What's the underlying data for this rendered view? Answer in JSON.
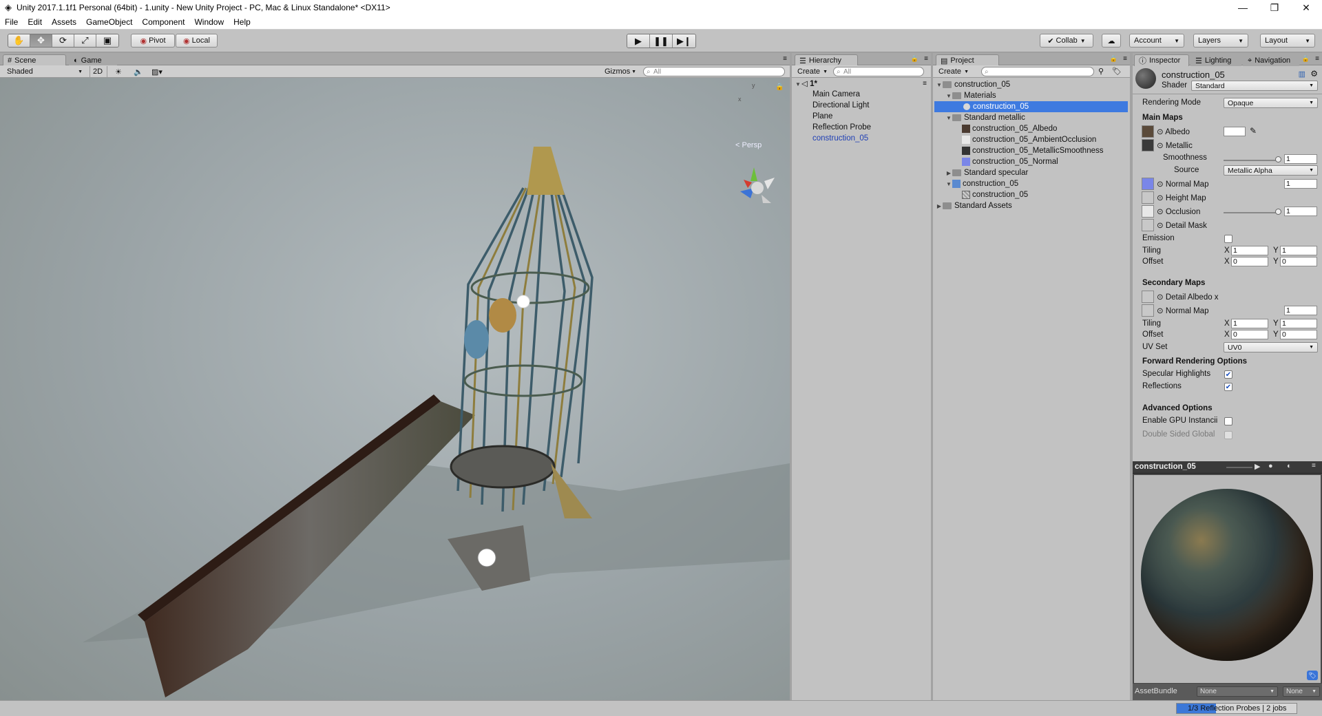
{
  "window": {
    "title": "Unity 2017.1.1f1 Personal (64bit) - 1.unity - New Unity Project - PC, Mac & Linux Standalone* <DX11>",
    "minimize": "—",
    "maximize": "❐",
    "close": "✕"
  },
  "menu": [
    "File",
    "Edit",
    "Assets",
    "GameObject",
    "Component",
    "Window",
    "Help"
  ],
  "toolbar": {
    "pivot": "Pivot",
    "local": "Local",
    "collab": "Collab",
    "account": "Account",
    "layers": "Layers",
    "layout": "Layout"
  },
  "scene": {
    "tab_scene": "Scene",
    "tab_game": "Game",
    "shading": "Shaded",
    "mode2d": "2D",
    "gizmos": "Gizmos",
    "search_placeholder": "All",
    "persp_label": "< Persp",
    "gizmo_y": "y",
    "gizmo_x": "x"
  },
  "hierarchy": {
    "tab": "Hierarchy",
    "create": "Create",
    "search_placeholder": "All",
    "scene_name": "1*",
    "items": [
      {
        "label": "Main Camera",
        "color": "#111111"
      },
      {
        "label": "Directional Light",
        "color": "#111111"
      },
      {
        "label": "Plane",
        "color": "#111111"
      },
      {
        "label": "Reflection Probe",
        "color": "#111111"
      },
      {
        "label": "construction_05",
        "color": "#1f3fb5"
      }
    ]
  },
  "project": {
    "tab": "Project",
    "create": "Create",
    "tree": [
      {
        "label": "construction_05",
        "type": "folder",
        "expanded": true
      },
      {
        "label": "Materials",
        "type": "folder",
        "expanded": true
      },
      {
        "label": "construction_05",
        "type": "material",
        "selected": true
      },
      {
        "label": "Standard metallic",
        "type": "folder",
        "expanded": true
      },
      {
        "label": "construction_05_Albedo",
        "type": "texture"
      },
      {
        "label": "construction_05_AmbientOcclusion",
        "type": "texture"
      },
      {
        "label": "construction_05_MetallicSmoothness",
        "type": "texture"
      },
      {
        "label": "construction_05_Normal",
        "type": "texture"
      },
      {
        "label": "Standard specular",
        "type": "folder",
        "expanded": false
      },
      {
        "label": "construction_05",
        "type": "prefab",
        "expanded": true
      },
      {
        "label": "construction_05",
        "type": "mesh"
      },
      {
        "label": "Standard Assets",
        "type": "folder",
        "expanded": false
      }
    ]
  },
  "inspector": {
    "tab_inspector": "Inspector",
    "tab_lighting": "Lighting",
    "tab_navigation": "Navigation",
    "material_name": "construction_05",
    "shader_label": "Shader",
    "shader_value": "Standard",
    "rendering_mode_label": "Rendering Mode",
    "rendering_mode_value": "Opaque",
    "main_maps": "Main Maps",
    "albedo": "Albedo",
    "metallic": "Metallic",
    "smoothness": "Smoothness",
    "smoothness_value": "1",
    "smoothness_level": 1.0,
    "source": "Source",
    "source_value": "Metallic Alpha",
    "normal_map": "Normal Map",
    "normal_map_value": "1",
    "height_map": "Height Map",
    "occlusion": "Occlusion",
    "occlusion_value": "1",
    "occlusion_level": 1.0,
    "detail_mask": "Detail Mask",
    "emission": "Emission",
    "emission_checked": false,
    "tiling": "Tiling",
    "offset": "Offset",
    "x": "X",
    "y": "Y",
    "main_tiling_x": "1",
    "main_tiling_y": "1",
    "main_offset_x": "0",
    "main_offset_y": "0",
    "secondary_maps": "Secondary Maps",
    "detail_albedo": "Detail Albedo x",
    "sec_normal_map": "Normal Map",
    "sec_normal_value": "1",
    "sec_tiling_x": "1",
    "sec_tiling_y": "1",
    "sec_offset_x": "0",
    "sec_offset_y": "0",
    "uv_set": "UV Set",
    "uv_set_value": "UV0",
    "forward_options": "Forward Rendering Options",
    "specular_highlights": "Specular Highlights",
    "specular_checked": true,
    "reflections": "Reflections",
    "reflections_checked": true,
    "advanced_options": "Advanced Options",
    "gpu_instancing": "Enable GPU Instancii",
    "double_sided": "Double Sided Global"
  },
  "preview": {
    "title": "construction_05",
    "assetbundle_label": "AssetBundle",
    "assetbundle_value": "None",
    "variant_value": "None"
  },
  "status": {
    "progress_text": "1/3 Reflection Probes | 2 jobs",
    "progress": 0.33
  },
  "colors": {
    "accent_selection": "#3e7ae0",
    "panel_bg": "#c2c2c2",
    "scene_bg": "#9aa3a6"
  }
}
